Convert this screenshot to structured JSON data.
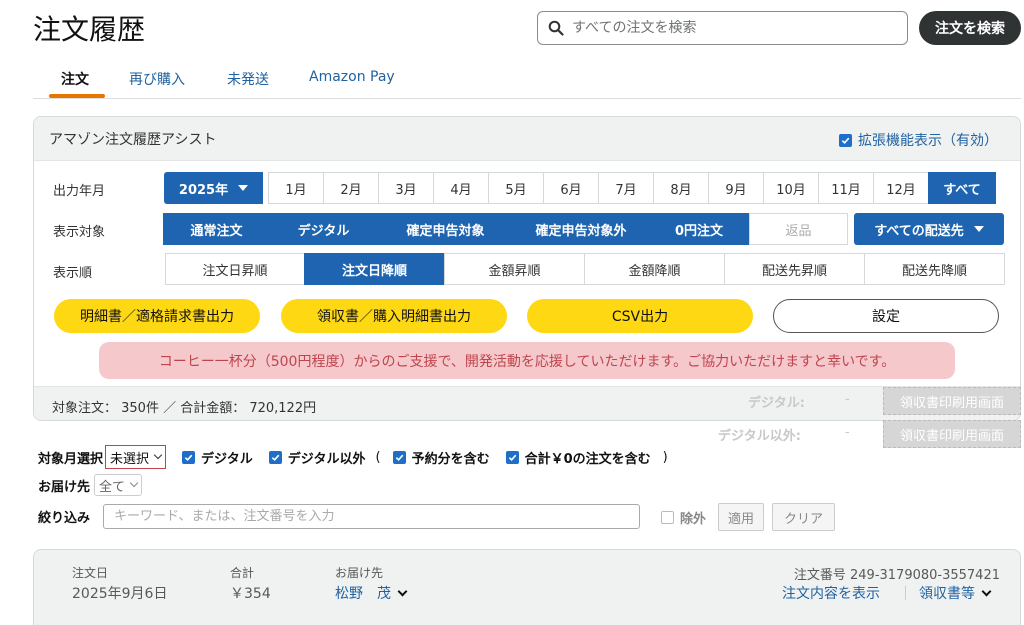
{
  "header": {
    "title": "注文履歴",
    "search_placeholder": "すべての注文を検索",
    "search_button": "注文を検索"
  },
  "tabs": [
    {
      "label": "注文",
      "active": true
    },
    {
      "label": "再び購入",
      "active": false
    },
    {
      "label": "未発送",
      "active": false
    },
    {
      "label": "Amazon Pay",
      "active": false
    }
  ],
  "assist": {
    "title": "アマゾン注文履歴アシスト",
    "extension_toggle": "拡張機能表示（有効）",
    "year_label": "出力年月",
    "year_value": "2025年",
    "months": [
      "1月",
      "2月",
      "3月",
      "4月",
      "5月",
      "6月",
      "7月",
      "8月",
      "9月",
      "10月",
      "11月",
      "12月"
    ],
    "all_months": "すべて",
    "target_label": "表示対象",
    "targets": [
      {
        "label": "通常注文",
        "on": true
      },
      {
        "label": "デジタル",
        "on": true
      },
      {
        "label": "確定申告対象",
        "on": true
      },
      {
        "label": "確定申告対象外",
        "on": true
      },
      {
        "label": "0円注文",
        "on": true
      },
      {
        "label": "返品",
        "on": false
      }
    ],
    "ship_to_button": "すべての配送先",
    "sort_label": "表示順",
    "sorts": [
      {
        "label": "注文日昇順",
        "on": false
      },
      {
        "label": "注文日降順",
        "on": true
      },
      {
        "label": "金額昇順",
        "on": false
      },
      {
        "label": "金額降順",
        "on": false
      },
      {
        "label": "配送先昇順",
        "on": false
      },
      {
        "label": "配送先降順",
        "on": false
      }
    ],
    "actions": {
      "invoice": "明細書／適格請求書出力",
      "receipt": "領収書／購入明細書出力",
      "csv": "CSV出力",
      "settings": "設定"
    },
    "support_message": "コーヒー一杯分（500円程度）からのご支援で、開発活動を応援していただけます。ご協力いただけますと幸いです。",
    "summary": "対象注文： 350件 ／ 合計金額： 720,122円",
    "digital_label": "デジタル:",
    "digital_value": "-",
    "non_digital_label": "デジタル以外:",
    "non_digital_value": "-",
    "print_button": "領収書印刷用画面"
  },
  "filters": {
    "month_label": "対象月選択",
    "month_select": "未選択",
    "check_digital": "デジタル",
    "check_non_digital": "デジタル以外",
    "paren_open": "(",
    "check_preorder": "予約分を含む",
    "check_zero": "合計￥0の注文を含む",
    "paren_close": ")",
    "ship_label": "お届け先",
    "ship_select": "全て",
    "keyword_label": "絞り込み",
    "keyword_placeholder": "キーワード、または、注文番号を入力",
    "exclude_label": "除外",
    "apply_button": "適用",
    "clear_button": "クリア"
  },
  "order": {
    "date_label": "注文日",
    "date_value": "2025年9月6日",
    "total_label": "合計",
    "total_value": "￥354",
    "ship_label": "お届け先",
    "ship_value": "松野　茂",
    "order_no": "注文番号 249-3179080-3557421",
    "view_details": "注文内容を表示",
    "receipt_link": "領収書等"
  },
  "colors": {
    "accent_blue": "#1e64b0",
    "link_blue": "#2162a1",
    "yellow": "#ffd814",
    "support_bg": "#f5c9cc",
    "support_text": "#c0444e",
    "tab_underline": "#e77600"
  }
}
